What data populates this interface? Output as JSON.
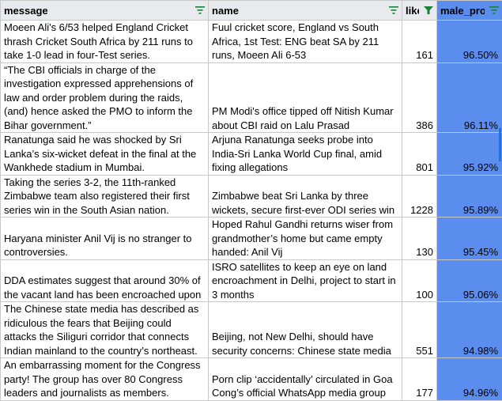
{
  "columns": {
    "message": "message",
    "name": "name",
    "like": "like",
    "male_pro": "male_pro"
  },
  "rows": [
    {
      "message": "Moeen Ali's 6/53 helped England Cricket thrash Cricket South Africa by 211 runs to take 1-0 lead in four-Test series.",
      "name": "Fuul cricket score, England vs South Africa, 1st Test: ENG beat SA by 211 runs, Moeen Ali 6-53",
      "like": "161",
      "male_pro": "96.50%"
    },
    {
      "message": "“The CBI officials in charge of the investigation expressed apprehensions of law and order problem during the raids, (and) hence asked the PMO to inform the Bihar government.”",
      "name": "PM Modi's office tipped off Nitish Kumar about CBI raid on Lalu Prasad",
      "like": "386",
      "male_pro": "96.11%"
    },
    {
      "message": "Ranatunga said he was shocked by Sri Lanka’s six-wicket defeat in the final at the Wankhede stadium in Mumbai.",
      "name": "Arjuna Ranatunga seeks probe into India-Sri Lanka World Cup final, amid fixing allegations",
      "like": "801",
      "male_pro": "95.92%"
    },
    {
      "message": "Taking the series 3-2, the 11th-ranked Zimbabwe team also registered their first series win in the South Asian nation.",
      "name": "Zimbabwe beat Sri Lanka by three wickets, secure first-ever ODI series win",
      "like": "1228",
      "male_pro": "95.89%"
    },
    {
      "message": "Haryana minister Anil Vij is no stranger to controversies.",
      "name": "Hoped Rahul Gandhi returns wiser from grandmother’s home but came empty handed: Anil Vij",
      "like": "130",
      "male_pro": "95.45%"
    },
    {
      "message": "DDA estimates suggest that around 30% of the vacant land has been encroached upon",
      "name": "ISRO satellites to keep an eye on land encroachment in Delhi, project to start in 3 months",
      "like": "100",
      "male_pro": "95.06%"
    },
    {
      "message": "The Chinese state media has described as ridiculous the fears that Beijing could attacks the Siliguri corridor that connects Indian mainland to the country’s northeast.",
      "name": "Beijing, not New Delhi, should have security concerns: Chinese state media",
      "like": "551",
      "male_pro": "94.98%"
    },
    {
      "message": "An embarrassing moment for the Congress party! The group has over 80 Congress leaders and journalists as members.",
      "name": "Porn clip ‘accidentally’ circulated in Goa Cong’s official WhatsApp media group",
      "like": "177",
      "male_pro": "94.96%"
    }
  ],
  "icons": {
    "filter": "filter-icon",
    "filter_active": "filter-active-icon"
  },
  "colors": {
    "header_bg": "#e8eaed",
    "highlight_column": "#5b8def",
    "filter_icon": "#188038",
    "selection": "#1a73e8"
  }
}
